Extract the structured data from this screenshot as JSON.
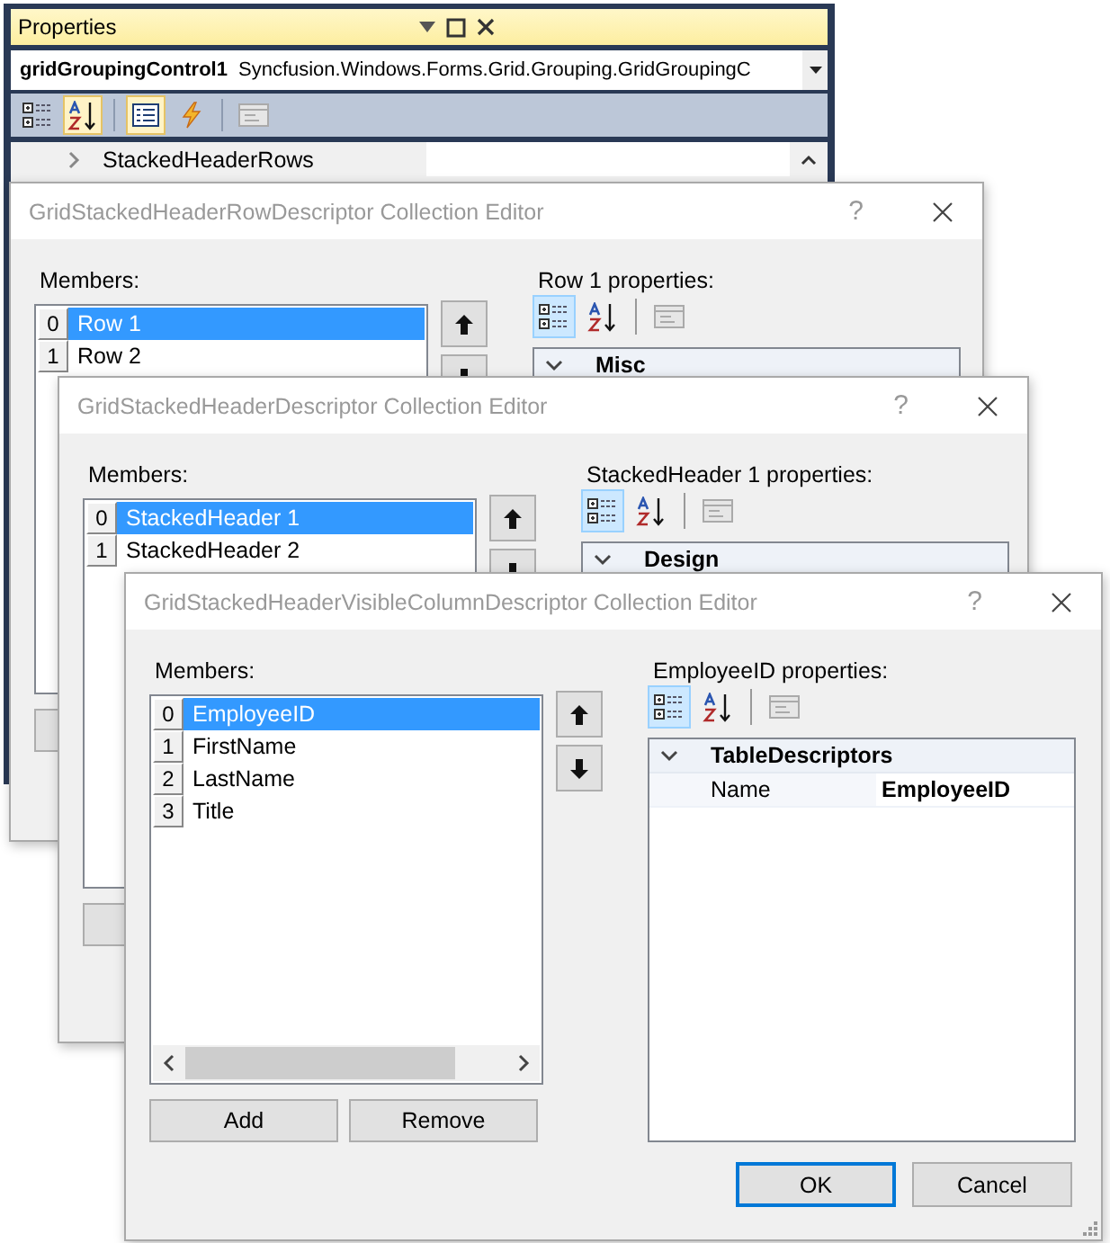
{
  "properties_window": {
    "title": "Properties",
    "object_name": "gridGroupingControl1",
    "object_type": "Syncfusion.Windows.Forms.Grid.Grouping.GridGroupingC",
    "toolbar": [
      {
        "kind": "categorized",
        "selected": false
      },
      {
        "kind": "alphabetical",
        "selected": true
      },
      {
        "kind": "properties",
        "selected": true
      },
      {
        "kind": "events",
        "selected": false
      },
      {
        "kind": "pages",
        "selected": false
      }
    ],
    "rows": [
      {
        "name": "StackedHeaderRows",
        "expanded": false
      }
    ]
  },
  "dialogs": [
    {
      "title": "GridStackedHeaderRowDescriptor Collection Editor",
      "help": "?",
      "members_label": "Members:",
      "members": [
        {
          "index": "0",
          "label": "Row 1",
          "selected": true
        },
        {
          "index": "1",
          "label": "Row 2",
          "selected": false
        }
      ],
      "move_buttons": [
        {
          "kind": "up"
        },
        {
          "kind": "down"
        }
      ],
      "properties_label": "Row 1 properties:",
      "grid_toolbar": [
        {
          "kind": "categorized",
          "selected": true
        },
        {
          "kind": "alphabetical",
          "selected": false
        },
        {
          "kind": "pages",
          "selected": false
        }
      ],
      "categories": [
        {
          "name": "Misc",
          "expanded": true
        }
      ]
    },
    {
      "title": "GridStackedHeaderDescriptor Collection Editor",
      "help": "?",
      "members_label": "Members:",
      "members": [
        {
          "index": "0",
          "label": "StackedHeader 1",
          "selected": true
        },
        {
          "index": "1",
          "label": "StackedHeader 2",
          "selected": false
        }
      ],
      "move_buttons": [
        {
          "kind": "up"
        },
        {
          "kind": "down"
        }
      ],
      "properties_label": "StackedHeader 1 properties:",
      "grid_toolbar": [
        {
          "kind": "categorized",
          "selected": true
        },
        {
          "kind": "alphabetical",
          "selected": false
        },
        {
          "kind": "pages",
          "selected": false
        }
      ],
      "categories": [
        {
          "name": "Design",
          "expanded": true
        }
      ]
    },
    {
      "title": "GridStackedHeaderVisibleColumnDescriptor Collection Editor",
      "help": "?",
      "members_label": "Members:",
      "members": [
        {
          "index": "0",
          "label": "EmployeeID",
          "selected": true
        },
        {
          "index": "1",
          "label": "FirstName",
          "selected": false
        },
        {
          "index": "2",
          "label": "LastName",
          "selected": false
        },
        {
          "index": "3",
          "label": "Title",
          "selected": false
        }
      ],
      "move_buttons": [
        {
          "kind": "up"
        },
        {
          "kind": "down"
        }
      ],
      "list_scrollbar": true,
      "bottom_buttons": [
        {
          "label": "Add"
        },
        {
          "label": "Remove"
        }
      ],
      "properties_label": "EmployeeID properties:",
      "grid_toolbar": [
        {
          "kind": "categorized",
          "selected": true
        },
        {
          "kind": "alphabetical",
          "selected": false
        },
        {
          "kind": "pages",
          "selected": false
        }
      ],
      "categories": [
        {
          "name": "TableDescriptors",
          "expanded": true,
          "properties": [
            {
              "name": "Name",
              "value": "EmployeeID"
            }
          ]
        }
      ],
      "footer_buttons": [
        {
          "label": "OK",
          "default": true
        },
        {
          "label": "Cancel",
          "default": false
        }
      ]
    }
  ]
}
